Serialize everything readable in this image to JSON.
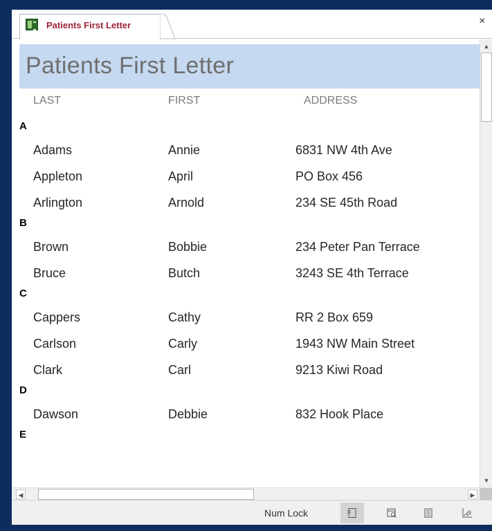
{
  "tab": {
    "title": "Patients First Letter",
    "close": "×"
  },
  "report": {
    "title": "Patients First Letter",
    "columns": [
      "LAST",
      "FIRST",
      "ADDRESS"
    ],
    "groups": [
      {
        "letter": "A",
        "rows": [
          {
            "last": "Adams",
            "first": "Annie",
            "address": "6831 NW 4th Ave"
          },
          {
            "last": "Appleton",
            "first": "April",
            "address": "PO Box 456"
          },
          {
            "last": "Arlington",
            "first": "Arnold",
            "address": "234 SE 45th Road"
          }
        ]
      },
      {
        "letter": "B",
        "rows": [
          {
            "last": "Brown",
            "first": "Bobbie",
            "address": "234 Peter Pan Terrace"
          },
          {
            "last": "Bruce",
            "first": "Butch",
            "address": "3243 SE 4th Terrace"
          }
        ]
      },
      {
        "letter": "C",
        "rows": [
          {
            "last": "Cappers",
            "first": "Cathy",
            "address": "RR 2 Box 659"
          },
          {
            "last": "Carlson",
            "first": "Carly",
            "address": "1943 NW Main Street"
          },
          {
            "last": "Clark",
            "first": "Carl",
            "address": "9213 Kiwi Road"
          }
        ]
      },
      {
        "letter": "D",
        "rows": [
          {
            "last": "Dawson",
            "first": "Debbie",
            "address": "832 Hook Place"
          }
        ]
      },
      {
        "letter": "E",
        "rows": []
      }
    ]
  },
  "status": {
    "num_lock": "Num Lock"
  },
  "icons": {
    "tab": "report-icon",
    "scroll_up": "chevron-up-icon",
    "scroll_down": "chevron-down-icon",
    "scroll_left": "chevron-left-icon",
    "scroll_right": "chevron-right-icon",
    "views": [
      "report-view-icon",
      "print-preview-icon",
      "layout-view-icon",
      "design-view-icon"
    ]
  },
  "colors": {
    "frame": "#0e2c5e",
    "header_band": "#c5d9f1",
    "tab_text": "#9b2335"
  }
}
